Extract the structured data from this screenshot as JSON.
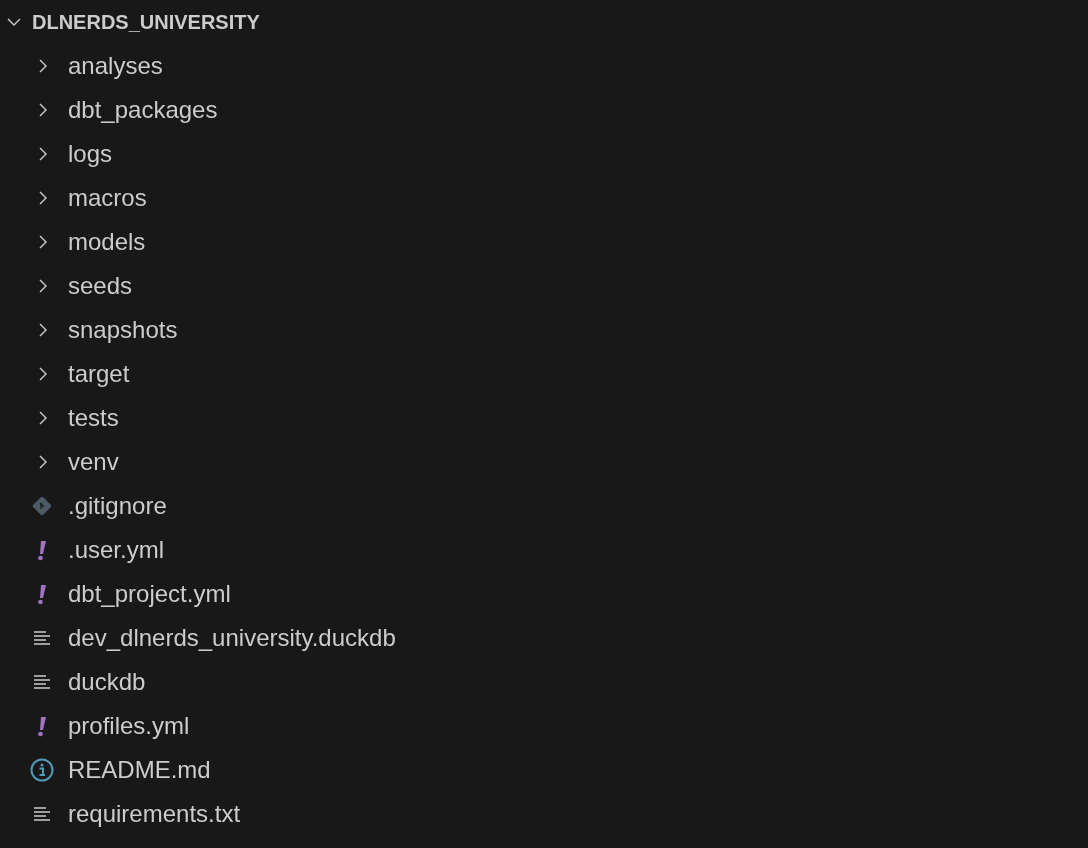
{
  "explorer": {
    "root": {
      "label": "DLNERDS_UNIVERSITY",
      "expanded": true
    },
    "items": [
      {
        "kind": "folder",
        "label": "analyses",
        "expanded": false
      },
      {
        "kind": "folder",
        "label": "dbt_packages",
        "expanded": false
      },
      {
        "kind": "folder",
        "label": "logs",
        "expanded": false
      },
      {
        "kind": "folder",
        "label": "macros",
        "expanded": false
      },
      {
        "kind": "folder",
        "label": "models",
        "expanded": false
      },
      {
        "kind": "folder",
        "label": "seeds",
        "expanded": false
      },
      {
        "kind": "folder",
        "label": "snapshots",
        "expanded": false
      },
      {
        "kind": "folder",
        "label": "target",
        "expanded": false
      },
      {
        "kind": "folder",
        "label": "tests",
        "expanded": false
      },
      {
        "kind": "folder",
        "label": "venv",
        "expanded": false
      },
      {
        "kind": "git",
        "label": ".gitignore"
      },
      {
        "kind": "yaml",
        "label": ".user.yml"
      },
      {
        "kind": "yaml",
        "label": "dbt_project.yml"
      },
      {
        "kind": "text",
        "label": "dev_dlnerds_university.duckdb"
      },
      {
        "kind": "text",
        "label": "duckdb"
      },
      {
        "kind": "yaml",
        "label": "profiles.yml"
      },
      {
        "kind": "info",
        "label": "README.md"
      },
      {
        "kind": "text",
        "label": "requirements.txt"
      }
    ]
  }
}
